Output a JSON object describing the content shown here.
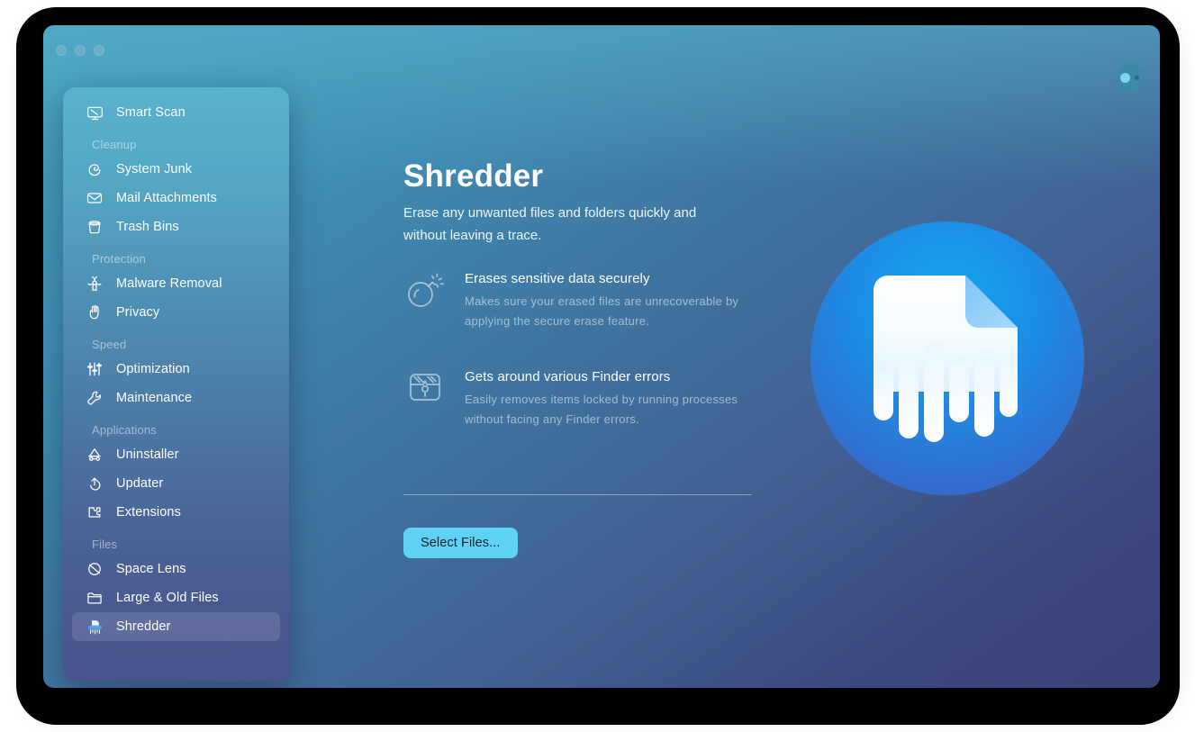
{
  "window": {
    "traffic_lights": [
      "close",
      "minimize",
      "zoom"
    ],
    "corner_button_name": "status-indicator"
  },
  "sidebar": {
    "groups": [
      {
        "section": null,
        "items": [
          {
            "label": "Smart Scan",
            "icon": "monitor-icon",
            "selected": false
          }
        ]
      },
      {
        "section": "Cleanup",
        "items": [
          {
            "label": "System Junk",
            "icon": "broom-icon",
            "selected": false
          },
          {
            "label": "Mail Attachments",
            "icon": "envelope-icon",
            "selected": false
          },
          {
            "label": "Trash Bins",
            "icon": "trash-bin-icon",
            "selected": false
          }
        ]
      },
      {
        "section": "Protection",
        "items": [
          {
            "label": "Malware Removal",
            "icon": "biohazard-icon",
            "selected": false
          },
          {
            "label": "Privacy",
            "icon": "hand-icon",
            "selected": false
          }
        ]
      },
      {
        "section": "Speed",
        "items": [
          {
            "label": "Optimization",
            "icon": "sliders-icon",
            "selected": false
          },
          {
            "label": "Maintenance",
            "icon": "wrench-icon",
            "selected": false
          }
        ]
      },
      {
        "section": "Applications",
        "items": [
          {
            "label": "Uninstaller",
            "icon": "uninstaller-icon",
            "selected": false
          },
          {
            "label": "Updater",
            "icon": "refresh-arrow-icon",
            "selected": false
          },
          {
            "label": "Extensions",
            "icon": "puzzle-piece-icon",
            "selected": false
          }
        ]
      },
      {
        "section": "Files",
        "items": [
          {
            "label": "Space Lens",
            "icon": "planet-icon",
            "selected": false
          },
          {
            "label": "Large & Old Files",
            "icon": "folder-icon",
            "selected": false
          },
          {
            "label": "Shredder",
            "icon": "shredder-icon",
            "selected": true
          }
        ]
      }
    ]
  },
  "main": {
    "title": "Shredder",
    "subtitle": "Erase any unwanted files and folders quickly and without leaving a trace.",
    "features": [
      {
        "icon": "bomb-icon",
        "title": "Erases sensitive data securely",
        "description": "Makes sure your erased files are unrecoverable by applying the secure erase feature."
      },
      {
        "icon": "locked-box-icon",
        "title": "Gets around various Finder errors",
        "description": "Easily removes items locked by running processes without facing any Finder errors."
      }
    ],
    "primary_button": "Select Files...",
    "hero_icon": "shredded-document-icon"
  },
  "colors": {
    "accent_button": "#5fd3f6",
    "sidebar_top": "#59b2cb",
    "sidebar_bottom": "#48538e",
    "window_top": "#43a0bf",
    "window_bottom": "#3a4279",
    "hero_circle_top": "#14a2e8",
    "hero_circle_bottom": "#3567c8"
  }
}
